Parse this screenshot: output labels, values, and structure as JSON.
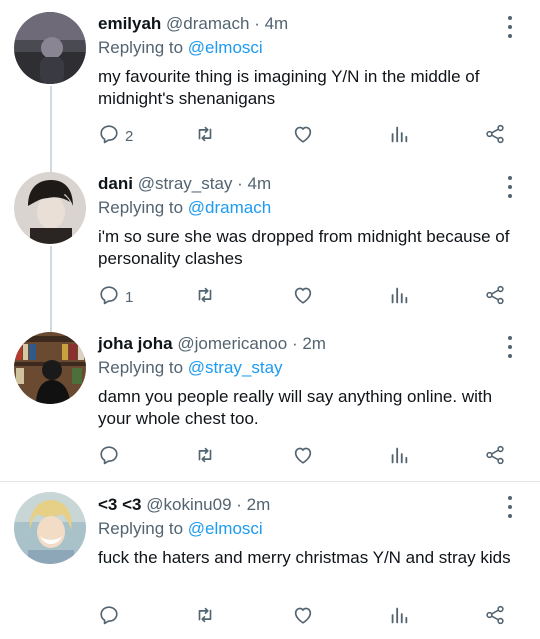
{
  "tweets": [
    {
      "name": "emilyah",
      "handle": "@dramach",
      "time": "· 4m",
      "replying_prefix": "Replying to",
      "replying_to": "@elmosci",
      "text": "my favourite thing is imagining Y/N in the middle of midnight's shenanigans",
      "reply_count": "2"
    },
    {
      "name": "dani",
      "handle": "@stray_stay",
      "time": "· 4m",
      "replying_prefix": "Replying to",
      "replying_to": "@dramach",
      "text": "i'm so sure she was dropped from midnight because of personality clashes",
      "reply_count": "1"
    },
    {
      "name": "joha joha",
      "handle": "@jomericanoo",
      "time": "· 2m",
      "replying_prefix": "Replying to",
      "replying_to": "@stray_stay",
      "text": "damn you people really will say anything online. with your whole chest too.",
      "reply_count": ""
    },
    {
      "name": "<3 <3",
      "handle": "@kokinu09",
      "time": "· 2m",
      "replying_prefix": "Replying to",
      "replying_to": "@elmosci",
      "text": "fuck the haters and merry christmas Y/N and stray kids",
      "reply_count": ""
    }
  ],
  "colors": {
    "link": "#1d9bf0",
    "muted": "#536471",
    "thread_line": "#cfd9de"
  },
  "icons": [
    "reply-icon",
    "retweet-icon",
    "like-icon",
    "views-icon",
    "share-icon",
    "more-icon"
  ]
}
